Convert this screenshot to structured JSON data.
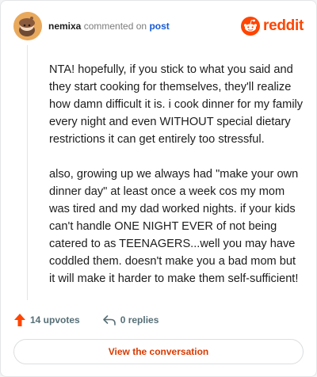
{
  "comment": {
    "author": "nemixa",
    "action_text": "commented on",
    "post_link": "post",
    "paragraphs": [
      "NTA! hopefully, if you stick to what you said and they start cooking for themselves, they'll realize how damn difficult it is. i cook dinner for my family every night and even WITHOUT special dietary restrictions it can get entirely too stressful.",
      "also, growing up we always had \"make your own dinner day\" at least once a week cos my mom was tired and my dad worked nights. if your kids can't handle ONE NIGHT EVER of not being catered to as TEENAGERS...well you may have coddled them. doesn't make you a bad mom but it will make it harder to make them self-sufficient!"
    ]
  },
  "brand": {
    "wordmark": "reddit",
    "accent": "#ff4500"
  },
  "actions": {
    "upvotes": "14 upvotes",
    "replies": "0 replies"
  },
  "view_button": {
    "label": "View the conversation"
  },
  "icons": {
    "avatar": "snoo-avatar-icon",
    "logo": "reddit-logo-icon",
    "upvote": "upvote-arrow-icon",
    "reply": "reply-arrow-icon"
  }
}
